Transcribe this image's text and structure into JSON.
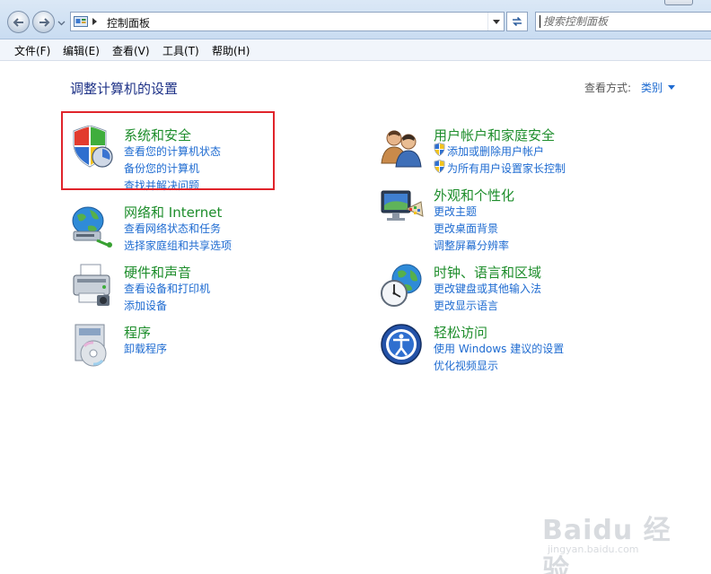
{
  "address_bar": {
    "path": "控制面板",
    "search_placeholder": "搜索控制面板"
  },
  "menu": [
    "文件(F)",
    "编辑(E)",
    "查看(V)",
    "工具(T)",
    "帮助(H)"
  ],
  "content": {
    "title": "调整计算机的设置",
    "view_by_label": "查看方式:",
    "view_by_value": "类别"
  },
  "categories": [
    {
      "title": "系统和安全",
      "icon": "shield-security-icon",
      "links": [
        "查看您的计算机状态",
        "备份您的计算机",
        "查找并解决问题"
      ],
      "highlighted": true
    },
    {
      "title": "网络和 Internet",
      "icon": "network-globe-icon",
      "links": [
        "查看网络状态和任务",
        "选择家庭组和共享选项"
      ]
    },
    {
      "title": "硬件和声音",
      "icon": "printer-hardware-icon",
      "links": [
        "查看设备和打印机",
        "添加设备"
      ]
    },
    {
      "title": "程序",
      "icon": "programs-disc-icon",
      "links": [
        "卸载程序"
      ]
    },
    {
      "title": "用户帐户和家庭安全",
      "icon": "users-icon",
      "links": [
        "添加或删除用户帐户",
        "为所有用户设置家长控制"
      ]
    },
    {
      "title": "外观和个性化",
      "icon": "monitor-palette-icon",
      "links": [
        "更改主题",
        "更改桌面背景",
        "调整屏幕分辨率"
      ]
    },
    {
      "title": "时钟、语言和区域",
      "icon": "clock-globe-icon",
      "links": [
        "更改键盘或其他输入法",
        "更改显示语言"
      ]
    },
    {
      "title": "轻松访问",
      "icon": "ease-of-access-icon",
      "links": [
        "使用 Windows 建议的设置",
        "优化视频显示"
      ]
    }
  ],
  "watermark": {
    "brand": "Baidu 经验",
    "url": "jingyan.baidu.com"
  }
}
